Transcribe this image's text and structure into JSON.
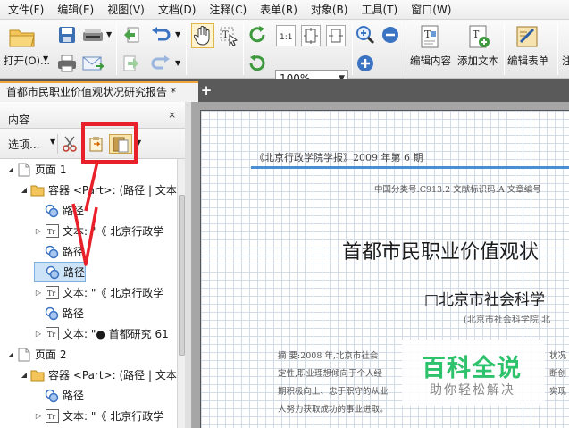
{
  "menubar": [
    "文件(F)",
    "编辑(E)",
    "视图(V)",
    "文档(D)",
    "注释(C)",
    "表单(R)",
    "对象(B)",
    "工具(T)",
    "窗口(W)"
  ],
  "toolbar": {
    "open_label": "打开(O)...",
    "zoom_value": "100%",
    "edit_content_label": "编辑内容",
    "add_text_label": "添加文本",
    "edit_form_label": "编辑表单",
    "cut_label": "注"
  },
  "tab": {
    "title": "首都市民职业价值观状况研究报告 *",
    "close": "×",
    "add": "+"
  },
  "panel": {
    "title": "内容",
    "close": "×",
    "options_label": "选项...",
    "tree": [
      {
        "label": "页面 1",
        "type": "page",
        "twisty": "◢"
      },
      {
        "label": "容器 <Part>: (路径 | 文本",
        "type": "container",
        "twisty": "◢"
      },
      {
        "label": "路径",
        "type": "path",
        "twisty": ""
      },
      {
        "label": "文本: \"《 北京行政学",
        "type": "text",
        "twisty": "▷"
      },
      {
        "label": "路径",
        "type": "path",
        "twisty": ""
      },
      {
        "label": "路径",
        "type": "path",
        "twisty": "",
        "selected": true
      },
      {
        "label": "文本: \"《 北京行政学",
        "type": "text",
        "twisty": "▷"
      },
      {
        "label": "路径",
        "type": "path",
        "twisty": ""
      },
      {
        "label": "文本: \"● 首都研究 61",
        "type": "text",
        "twisty": "▷"
      },
      {
        "label": "页面 2",
        "type": "page",
        "twisty": "◢"
      },
      {
        "label": "容器 <Part>: (路径 | 文本",
        "type": "container",
        "twisty": "◢"
      },
      {
        "label": "路径",
        "type": "path",
        "twisty": ""
      },
      {
        "label": "文本: \"《 北京行政学",
        "type": "text",
        "twisty": "▷"
      }
    ]
  },
  "document": {
    "journal": "《北京行政学院学报》2009 年第 6 期",
    "classification": "中国分类号:C913.2    文献标识码:A    文章编号",
    "title": "首都市民职业价值观状",
    "author": "□北京市社会科学",
    "affiliation": "(北京市社会科学院,北",
    "abstract_lines": [
      "摘   要:2008 年,北京市社会",
      "定性,职业理想倾向于个人经",
      "期积极向上、忠于职守的从业",
      "人努力获取成功的事业进取。"
    ],
    "abstract_tails": [
      "状况",
      "断创",
      "实现",
      ""
    ]
  },
  "watermark": {
    "title": "百科全说",
    "subtitle": "助你轻松解决"
  },
  "colors": {
    "accent": "#f0a63a",
    "annotation": "#e8202a",
    "rule": "#4a8fd4",
    "brand": "#2dc26b"
  }
}
